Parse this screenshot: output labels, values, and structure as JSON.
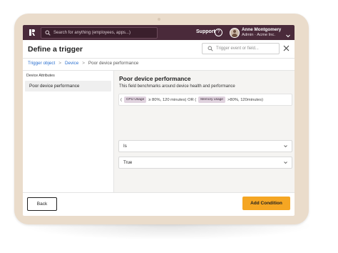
{
  "topbar": {
    "search_placeholder": "Search for anything (employees, apps...)",
    "support_label": "Support",
    "help_glyph": "?",
    "user_name": "Anne Montgomery",
    "user_role": "Admin · Acme Inc."
  },
  "header": {
    "title": "Define a trigger",
    "search_placeholder": "Trigger event or field..."
  },
  "breadcrumb": {
    "items": [
      "Trigger object",
      "Device",
      "Poor device performance"
    ],
    "separator": ">"
  },
  "sidebar": {
    "heading": "Device Attributes",
    "items": [
      {
        "label": "Poor device performance",
        "selected": true
      }
    ]
  },
  "detail": {
    "title": "Poor device performance",
    "description": "This field benchmarks around device health and performance",
    "expression": {
      "open_paren": "(",
      "tag1": "CPU Usage",
      "part1": "≥ 80%, 120 minutes) OR (",
      "tag2": "Memory usage",
      "part2": ">80%, 120minutes)"
    },
    "operator_value": "Is",
    "value_value": "True"
  },
  "footer": {
    "back_label": "Back",
    "add_label": "Add Condition"
  },
  "colors": {
    "topbar": "#4a2a3a",
    "tablet_frame": "#eadccb",
    "accent_button": "#f5a623",
    "link": "#2a6fcf",
    "tag_bg": "#e0d3df"
  }
}
